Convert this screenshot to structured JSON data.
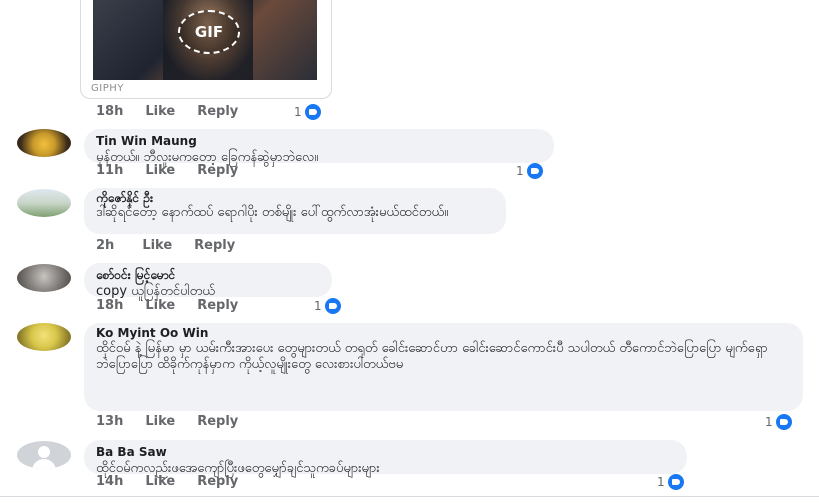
{
  "gif": {
    "badge": "GIF",
    "source": "GIPHY"
  },
  "actions": {
    "like": "Like",
    "reply": "Reply"
  },
  "top_meta": {
    "time": "18h",
    "reactions": "1"
  },
  "comments": [
    {
      "name": "Tin Win Maung",
      "text": "မှန်တယ်။ ဘီလူးမကတော့ ခြေကန်ဆွဲမှာဘဲလေ။",
      "time": "11h",
      "reactions": "1"
    },
    {
      "name": "ကိုဇော်နိုင် ဦး",
      "text": "ဒါဆိုရင်တော့ နောက်ထပ် ရောဂါပိုး တစ်မျိုး ပေါ်ထွက်လာအုံးမယ်ထင်တယ်။",
      "time": "2h",
      "reactions": ""
    },
    {
      "name": "စော်ဝင်း မြင့်မောင်",
      "text": "copy ယူပြန်တင်ပါတယ်",
      "time": "18h",
      "reactions": "1"
    },
    {
      "name": "Ko Myint Oo Win",
      "text": "ထိုင်ဝမ် နဲ့ မြန်မာ မှာ ယမ်းကီးအားပေး တွေများတယ် တရုတ် ခေါင်းဆောင်ဟာ ခေါင်းဆောင်ကောင်းပီ သပါတယ် တီကောင်ဘဲပြောပြော မျက်ရှော ဘဲပြောပြော ထိခိုက်ကုန်မှာက ကိုယ့်လူမျိုးတွေ လေးစားပါတယ်ဗမ",
      "time": "13h",
      "reactions": "1"
    },
    {
      "name": "Ba Ba Saw",
      "text": "ထိုင်ဝမ်ကလည်းဖအေကျော်ပြီးဖတွေမျှော်ချင်သူကခပ်များများ",
      "time": "14h",
      "reactions": "1"
    }
  ]
}
